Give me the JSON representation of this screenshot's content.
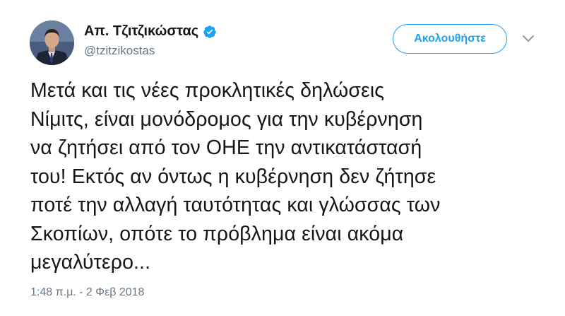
{
  "user": {
    "name": "Απ. Τζιτζικώστας",
    "handle": "@tzitzikostas",
    "verified": true
  },
  "follow_button": {
    "label": "Ακολουθήστε"
  },
  "tweet": {
    "lines": [
      "Μετά και τις νέες προκλητικές δηλώσεις",
      "Νίμιτς, είναι μονόδρομος για την κυβέρνηση",
      "να ζητήσει από τον ΟΗΕ την αντικατάστασή",
      "του! Εκτός αν όντως η κυβέρνηση δεν ζήτησε",
      "ποτέ την αλλαγή ταυτότητας και γλώσσας των",
      "Σκοπίων, οπότε το πρόβλημα είναι ακόμα",
      "μεγαλύτερο..."
    ],
    "timestamp": "1:48 π.μ. - 2 Φεβ 2018"
  },
  "colors": {
    "accent": "#1da1f2",
    "text": "#14171a",
    "secondary": "#657786"
  },
  "icons": {
    "verified": "verified-badge-icon",
    "menu": "chevron-down-icon"
  }
}
